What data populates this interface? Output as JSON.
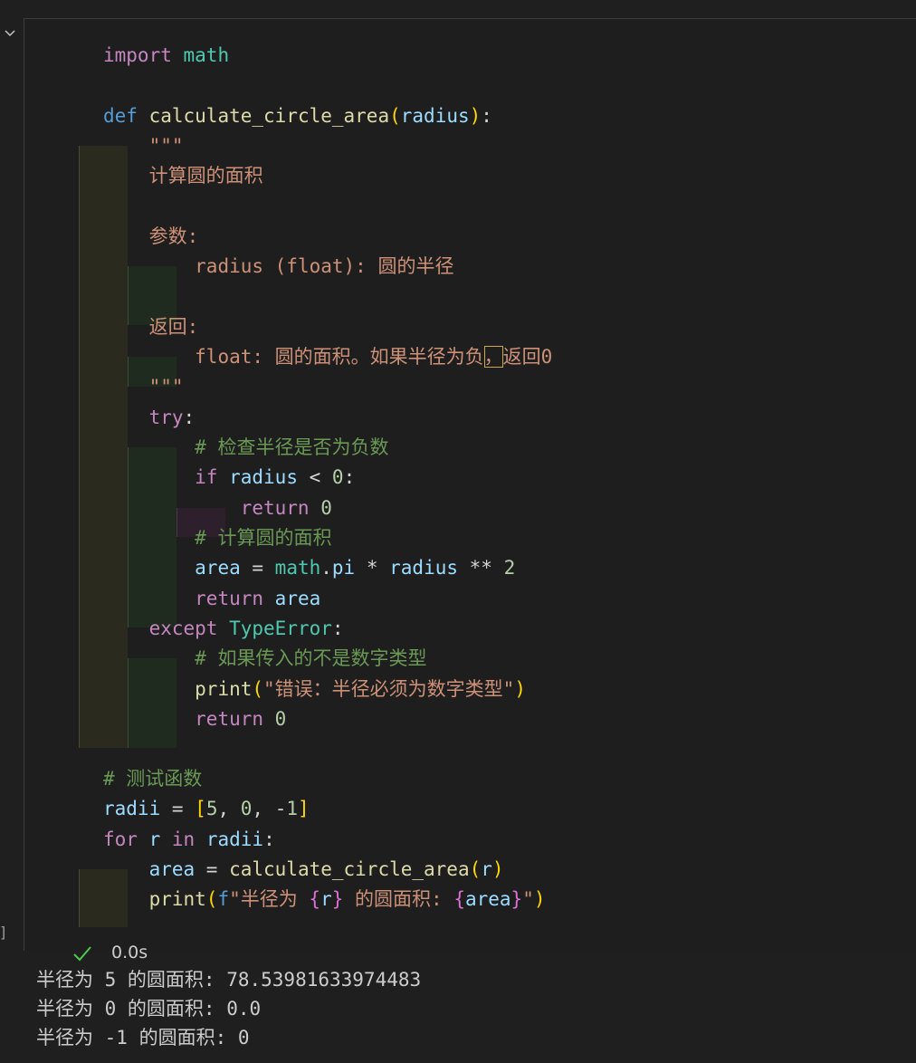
{
  "cell": {
    "lines": [
      {
        "t": "import math"
      },
      {
        "t": ""
      },
      {
        "t": "def calculate_circle_area(radius):"
      },
      {
        "t": "    \"\"\""
      },
      {
        "t": "    计算圆的面积"
      },
      {
        "t": ""
      },
      {
        "t": "    参数:"
      },
      {
        "t": "        radius (float): 圆的半径"
      },
      {
        "t": ""
      },
      {
        "t": "    返回:"
      },
      {
        "t": "        float: 圆的面积。如果半径为负，返回0"
      },
      {
        "t": "    \"\"\""
      },
      {
        "t": "    try:"
      },
      {
        "t": "        # 检查半径是否为负数"
      },
      {
        "t": "        if radius < 0:"
      },
      {
        "t": "            return 0"
      },
      {
        "t": "        # 计算圆的面积"
      },
      {
        "t": "        area = math.pi * radius ** 2"
      },
      {
        "t": "        return area"
      },
      {
        "t": "    except TypeError:"
      },
      {
        "t": "        # 如果传入的不是数字类型"
      },
      {
        "t": "        print(\"错误：半径必须为数字类型\")"
      },
      {
        "t": "        return 0"
      },
      {
        "t": ""
      },
      {
        "t": "# 测试函数"
      },
      {
        "t": "radii = [5, 0, -1]"
      },
      {
        "t": "for r in radii:"
      },
      {
        "t": "    area = calculate_circle_area(r)"
      },
      {
        "t": "    print(f\"半径为 {r} 的圆面积: {area}\")"
      }
    ]
  },
  "status": {
    "icon": "check-icon",
    "time": "0.0s",
    "bracket": "]",
    "color": "#4ec94e"
  },
  "output": {
    "lines": [
      "半径为 5 的圆面积: 78.53981633974483",
      "半径为 0 的圆面积: 0.0",
      "半径为 -1 的圆面积: 0"
    ]
  }
}
